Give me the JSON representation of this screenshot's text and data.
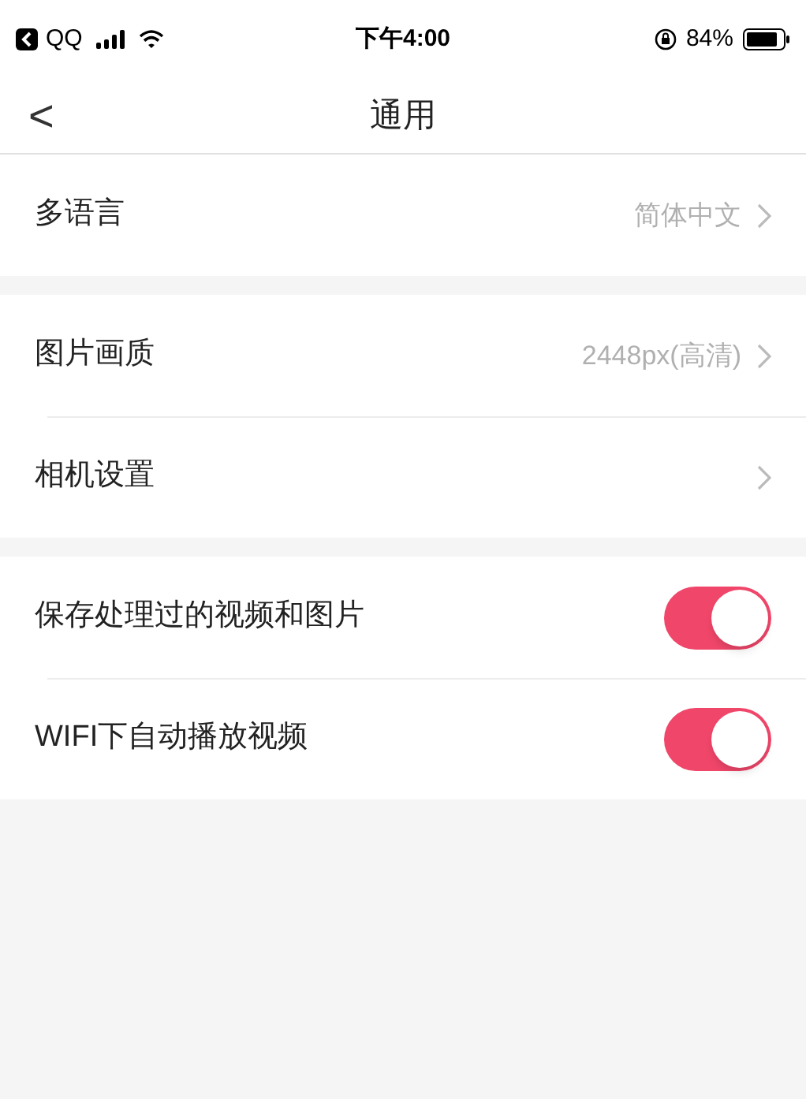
{
  "status_bar": {
    "carrier": "QQ",
    "time": "下午4:00",
    "battery_percent": "84%"
  },
  "nav": {
    "back": "<",
    "title": "通用"
  },
  "sections": [
    {
      "items": [
        {
          "kind": "link",
          "label": "多语言",
          "value": "简体中文"
        }
      ]
    },
    {
      "items": [
        {
          "kind": "link",
          "label": "图片画质",
          "value": "2448px(高清)"
        },
        {
          "kind": "link",
          "label": "相机设置"
        }
      ]
    },
    {
      "items": [
        {
          "kind": "toggle",
          "label": "保存处理过的视频和图片",
          "on": true
        },
        {
          "kind": "toggle",
          "label": "WIFI下自动播放视频",
          "on": true
        }
      ]
    }
  ]
}
